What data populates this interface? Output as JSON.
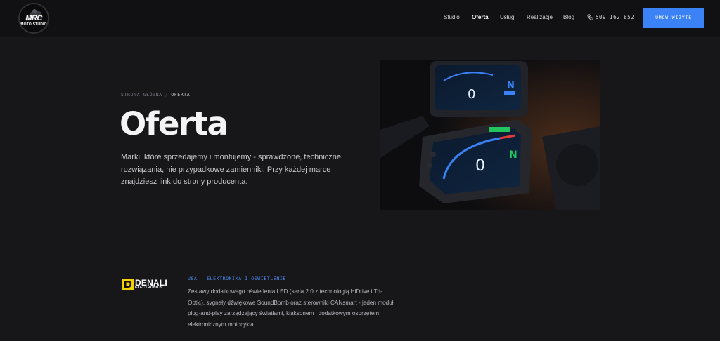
{
  "header": {
    "logo": {
      "line1": "MRC",
      "line2": "MOTO STUDIO"
    },
    "nav": [
      {
        "label": "Studio",
        "active": false
      },
      {
        "label": "Oferta",
        "active": true
      },
      {
        "label": "Usługi",
        "active": false
      },
      {
        "label": "Realizacje",
        "active": false
      },
      {
        "label": "Blog",
        "active": false
      }
    ],
    "phone": "509 162 852",
    "phone_icon": "phone-icon",
    "cta_label": "UMÓW WIZYTĘ",
    "accent_color": "#3b82f6"
  },
  "breadcrumb": {
    "home": "STRONA GŁÓWNA",
    "separator": "/",
    "current": "OFERTA"
  },
  "hero": {
    "title": "Oferta",
    "description": "Marki, które sprzedajemy i montujemy - sprawdzone, techniczne rozwiązania, nie przypadkowe zamienniki. Przy każdej marce znajdziesz link do strony producenta."
  },
  "brands": [
    {
      "logo_word": "DENALI",
      "logo_sub": "ELECTRONICS",
      "category": "USA - ELEKTRONIKA I OŚWIETLENIE",
      "description": "Zestawy dodatkowego oświetlenia LED (seria 2.0 z technologią HiDrive i Tri-Optic), sygnały dźwiękowe SoundBomb oraz sterowniki CANsmart - jeden moduł plug-and-play zarządzający światłami, klaksonem i dodatkowym osprzętem elektronicznym motocykla."
    }
  ]
}
